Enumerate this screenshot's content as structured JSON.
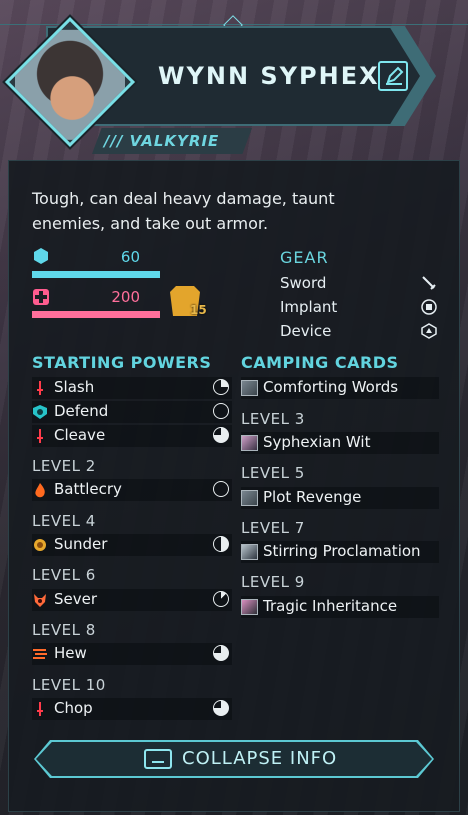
{
  "character": {
    "name": "WYNN SYPHEX",
    "class": "/// VALKYRIE",
    "description": "Tough, can deal heavy damage, taunt enemies, and take out armor."
  },
  "stats": {
    "armor": "60",
    "health": "200",
    "badge_level": "15",
    "armor_color": "#5fd8ea",
    "health_color": "#ff5c8f"
  },
  "gear": {
    "title": "GEAR",
    "items": [
      {
        "label": "Sword",
        "icon": "sword-icon"
      },
      {
        "label": "Implant",
        "icon": "implant-icon"
      },
      {
        "label": "Device",
        "icon": "device-icon"
      }
    ]
  },
  "powers": {
    "title": "STARTING POWERS",
    "starting": [
      {
        "label": "Slash",
        "icon": "dagger-icon",
        "cost": "clock-quarter-icon"
      },
      {
        "label": "Defend",
        "icon": "shield-icon",
        "cost": "clock-empty-icon"
      },
      {
        "label": "Cleave",
        "icon": "dagger-icon",
        "cost": "clock-three-quarter-icon"
      }
    ],
    "levels": [
      {
        "level": "LEVEL 2",
        "label": "Battlecry",
        "icon": "flame-icon",
        "cost": "clock-empty-icon"
      },
      {
        "level": "LEVEL 4",
        "label": "Sunder",
        "icon": "burst-icon",
        "cost": "clock-half-icon"
      },
      {
        "level": "LEVEL 6",
        "label": "Sever",
        "icon": "demon-icon",
        "cost": "clock-eighth-icon"
      },
      {
        "level": "LEVEL 8",
        "label": "Hew",
        "icon": "slash-lines-icon",
        "cost": "clock-three-quarter-icon"
      },
      {
        "level": "LEVEL 10",
        "label": "Chop",
        "icon": "dagger-icon",
        "cost": "clock-three-quarter-icon"
      }
    ]
  },
  "camping": {
    "title": "CAMPING CARDS",
    "starting": [
      {
        "label": "Comforting Words"
      }
    ],
    "levels": [
      {
        "level": "LEVEL 3",
        "label": "Syphexian Wit"
      },
      {
        "level": "LEVEL 5",
        "label": "Plot Revenge"
      },
      {
        "level": "LEVEL 7",
        "label": "Stirring Proclamation"
      },
      {
        "level": "LEVEL 9",
        "label": "Tragic Inheritance"
      }
    ]
  },
  "footer": {
    "collapse_label": "COLLAPSE INFO"
  }
}
